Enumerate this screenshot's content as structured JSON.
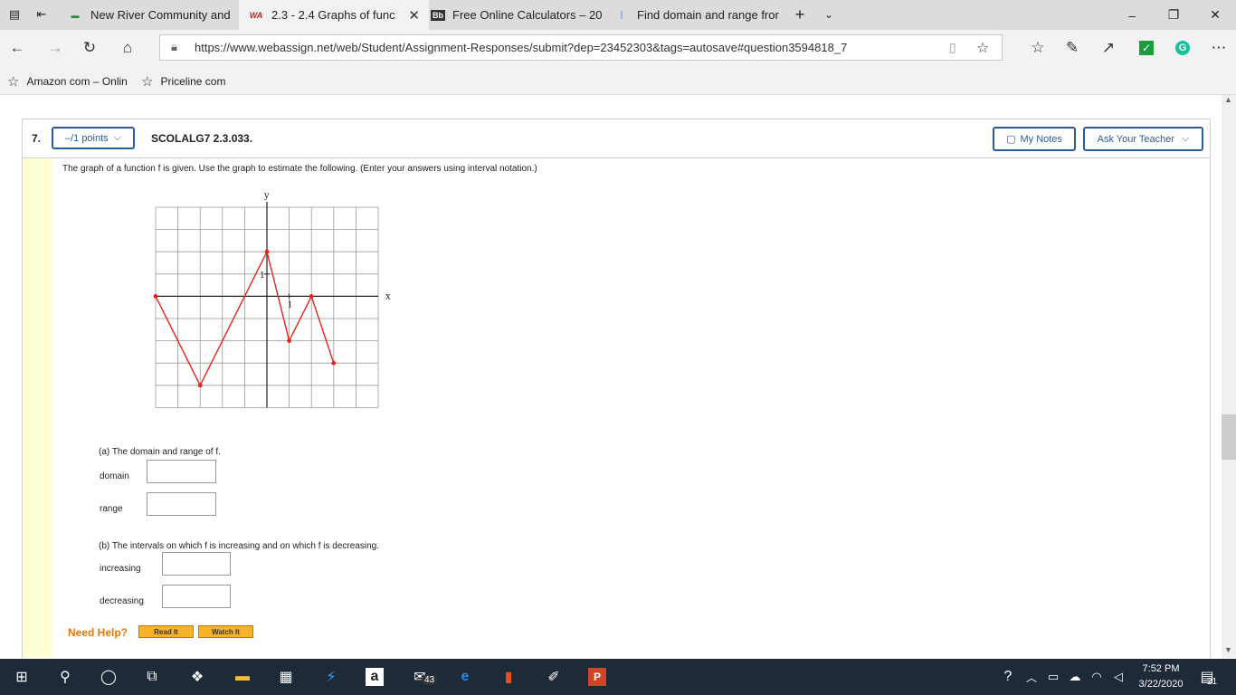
{
  "tabs": [
    {
      "label": "New River Community and ",
      "icon": "newriver-icon"
    },
    {
      "label": "2.3 - 2.4 Graphs of func",
      "icon": "webassign-icon",
      "active": true
    },
    {
      "label": "Free Online Calculators – 20",
      "icon": "blackboard-icon",
      "fav_text": "Bb"
    },
    {
      "label": "Find domain and range fror",
      "icon": "page-icon"
    }
  ],
  "address": {
    "url": "https://www.webassign.net/web/Student/Assignment-Responses/submit?dep=23452303&tags=autosave#question3594818_7"
  },
  "favorites": [
    {
      "label": "Amazon com – Onlin"
    },
    {
      "label": "Priceline com"
    }
  ],
  "question": {
    "number": "7.",
    "points": "–/1 points",
    "code": "SCOLALG7 2.3.033.",
    "my_notes": "My Notes",
    "ask_teacher": "Ask Your Teacher",
    "prompt": "The graph of a function f is given. Use the graph to estimate the following. (Enter your answers using interval notation.)",
    "part_a": "(a) The domain and range of f.",
    "domain_label": "domain",
    "range_label": "range",
    "part_b": "(b) The intervals on which f is increasing and on which f is decreasing.",
    "increasing_label": "increasing",
    "decreasing_label": "decreasing",
    "need_help": "Need Help?",
    "read_it": "Read It",
    "watch_it": "Watch It"
  },
  "graph": {
    "x_label": "x",
    "y_label": "y",
    "x_tick": "1",
    "y_tick": "1",
    "xlim": [
      -5,
      5
    ],
    "ylim": [
      -5,
      4
    ],
    "points": [
      [
        -5,
        0
      ],
      [
        -3,
        -4
      ],
      [
        0,
        2
      ],
      [
        1,
        -2
      ],
      [
        2,
        0
      ],
      [
        3,
        -3
      ]
    ],
    "line_color": "#e8231c"
  },
  "taskbar": {
    "time": "7:52 PM",
    "date": "3/22/2020",
    "mail_badge": "43",
    "notif_badge": "21"
  }
}
